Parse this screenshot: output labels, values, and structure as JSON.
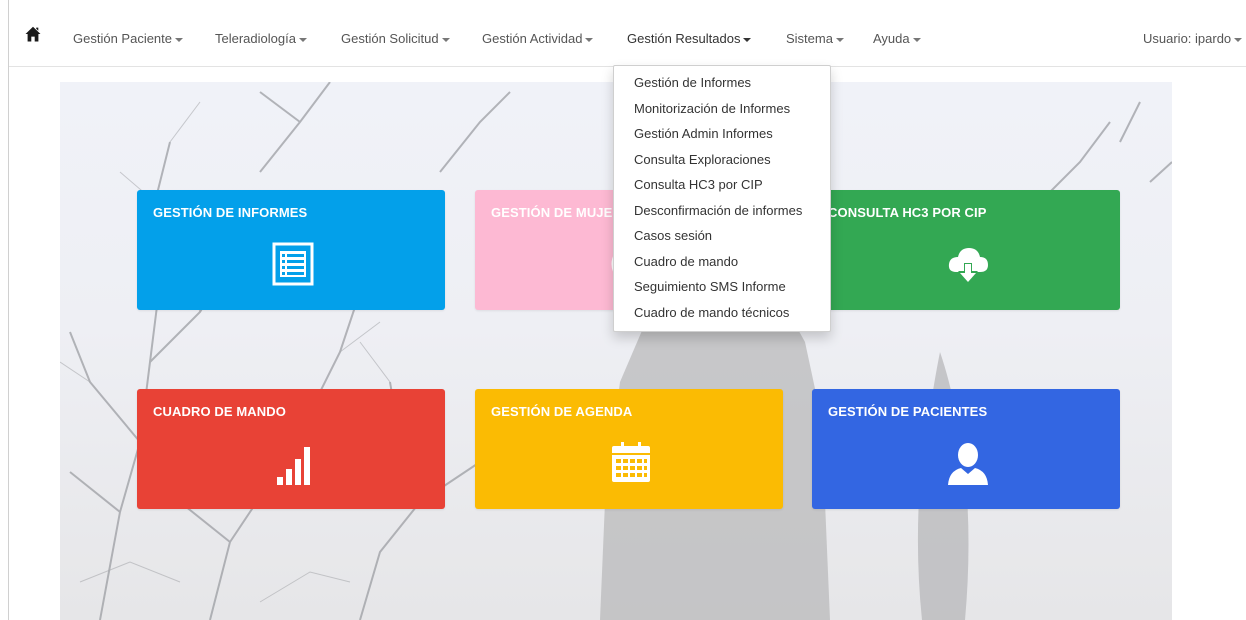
{
  "navbar": {
    "home_icon": "home-icon",
    "items": [
      {
        "label": "Gestión Paciente"
      },
      {
        "label": "Teleradiología"
      },
      {
        "label": "Gestión Solicitud"
      },
      {
        "label": "Gestión Actividad"
      },
      {
        "label": "Gestión Resultados"
      },
      {
        "label": "Sistema"
      },
      {
        "label": "Ayuda"
      }
    ],
    "user_label": "Usuario: ipardo"
  },
  "dropdown": {
    "items": [
      "Gestión de Informes",
      "Monitorización de Informes",
      "Gestión Admin Informes",
      "Consulta Exploraciones",
      "Consulta HC3 por CIP",
      "Desconfirmación de informes",
      "Casos sesión",
      "Cuadro de mando",
      "Seguimiento SMS Informe",
      "Cuadro de mando técnicos"
    ]
  },
  "tiles": [
    {
      "label": "GESTIÓN DE INFORMES",
      "color": "#03a0ea",
      "icon": "report-list-icon"
    },
    {
      "label": "GESTIÓN DE MUJE",
      "color": "#fdb9d3",
      "icon": "women-icon"
    },
    {
      "label": "CONSULTA HC3 POR CIP",
      "color": "#33a853",
      "icon": "cloud-download-icon"
    },
    {
      "label": "CUADRO DE MANDO",
      "color": "#e84236",
      "icon": "bar-chart-icon"
    },
    {
      "label": "GESTIÓN DE AGENDA",
      "color": "#fbbb03",
      "icon": "calendar-icon"
    },
    {
      "label": "GESTIÓN DE PACIENTES",
      "color": "#3366e2",
      "icon": "user-icon"
    }
  ]
}
